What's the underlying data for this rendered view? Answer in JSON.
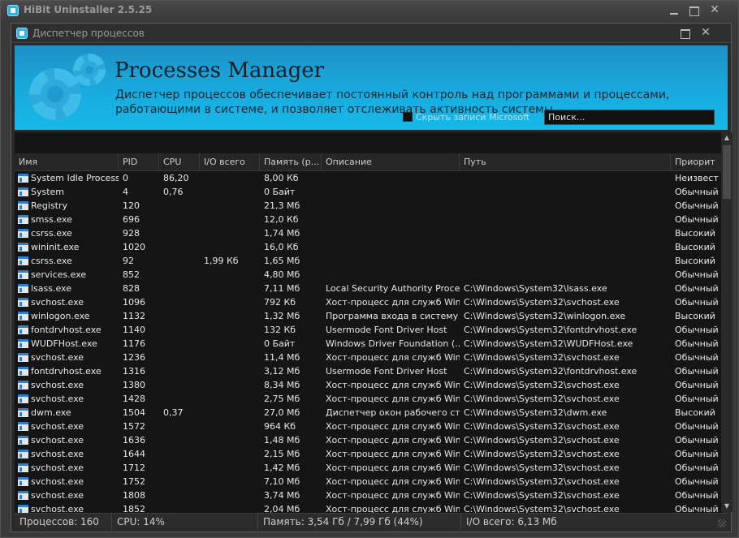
{
  "app": {
    "outer_title": "HiBit Uninstaller 2.5.25",
    "inner_title": "Диспетчер процессов"
  },
  "banner": {
    "title": "Processes Manager",
    "description": "Диспетчер процессов обеспечивает постоянный контроль над программами и процессами, работающими в системе, и позволяет отслеживать активность системы",
    "hide_ms_label": "Скрыть записи Microsoft",
    "search_placeholder": "Поиск..."
  },
  "colors": {
    "accent": "#1aa7db",
    "background": "#151515"
  },
  "table": {
    "columns": [
      "Имя",
      "PID",
      "CPU",
      "I/O всего",
      "Память (р...",
      "Описание",
      "Путь",
      "Приорит"
    ],
    "rows": [
      [
        "System Idle Process",
        "0",
        "86,20",
        "",
        "8,00 Кб",
        "",
        "",
        "Неизвест"
      ],
      [
        "System",
        "4",
        "0,76",
        "",
        "0 Байт",
        "",
        "",
        "Обычный"
      ],
      [
        "Registry",
        "120",
        "",
        "",
        "21,3 Мб",
        "",
        "",
        "Обычный"
      ],
      [
        "smss.exe",
        "696",
        "",
        "",
        "12,0 Кб",
        "",
        "",
        "Обычный"
      ],
      [
        "csrss.exe",
        "928",
        "",
        "",
        "1,74 Мб",
        "",
        "",
        "Высокий"
      ],
      [
        "wininit.exe",
        "1020",
        "",
        "",
        "16,0 Кб",
        "",
        "",
        "Высокий"
      ],
      [
        "csrss.exe",
        "92",
        "",
        "1,99 Кб",
        "1,65 Мб",
        "",
        "",
        "Высокий"
      ],
      [
        "services.exe",
        "852",
        "",
        "",
        "4,80 Мб",
        "",
        "",
        "Обычный"
      ],
      [
        "lsass.exe",
        "828",
        "",
        "",
        "7,11 Мб",
        "Local Security Authority Process",
        "C:\\Windows\\System32\\lsass.exe",
        "Обычный"
      ],
      [
        "svchost.exe",
        "1096",
        "",
        "",
        "792 Кб",
        "Хост-процесс для служб Win...",
        "C:\\Windows\\System32\\svchost.exe",
        "Обычный"
      ],
      [
        "winlogon.exe",
        "1132",
        "",
        "",
        "1,32 Мб",
        "Программа входа в систему ...",
        "C:\\Windows\\System32\\winlogon.exe",
        "Высокий"
      ],
      [
        "fontdrvhost.exe",
        "1140",
        "",
        "",
        "132 Кб",
        "Usermode Font Driver Host",
        "C:\\Windows\\System32\\fontdrvhost.exe",
        "Обычный"
      ],
      [
        "WUDFHost.exe",
        "1176",
        "",
        "",
        "0 Байт",
        "Windows Driver Foundation (...",
        "C:\\Windows\\System32\\WUDFHost.exe",
        "Обычный"
      ],
      [
        "svchost.exe",
        "1236",
        "",
        "",
        "11,4 Мб",
        "Хост-процесс для служб Win...",
        "C:\\Windows\\System32\\svchost.exe",
        "Обычный"
      ],
      [
        "fontdrvhost.exe",
        "1316",
        "",
        "",
        "3,12 Мб",
        "Usermode Font Driver Host",
        "C:\\Windows\\System32\\fontdrvhost.exe",
        "Обычный"
      ],
      [
        "svchost.exe",
        "1380",
        "",
        "",
        "8,34 Мб",
        "Хост-процесс для служб Win...",
        "C:\\Windows\\System32\\svchost.exe",
        "Обычный"
      ],
      [
        "svchost.exe",
        "1428",
        "",
        "",
        "2,75 Мб",
        "Хост-процесс для служб Win...",
        "C:\\Windows\\System32\\svchost.exe",
        "Обычный"
      ],
      [
        "dwm.exe",
        "1504",
        "0,37",
        "",
        "27,0 Мб",
        "Диспетчер окон рабочего ст...",
        "C:\\Windows\\System32\\dwm.exe",
        "Высокий"
      ],
      [
        "svchost.exe",
        "1572",
        "",
        "",
        "964 Кб",
        "Хост-процесс для служб Win...",
        "C:\\Windows\\System32\\svchost.exe",
        "Обычный"
      ],
      [
        "svchost.exe",
        "1636",
        "",
        "",
        "1,48 Мб",
        "Хост-процесс для служб Win...",
        "C:\\Windows\\System32\\svchost.exe",
        "Обычный"
      ],
      [
        "svchost.exe",
        "1644",
        "",
        "",
        "2,15 Мб",
        "Хост-процесс для служб Win...",
        "C:\\Windows\\System32\\svchost.exe",
        "Обычный"
      ],
      [
        "svchost.exe",
        "1712",
        "",
        "",
        "1,42 Мб",
        "Хост-процесс для служб Win...",
        "C:\\Windows\\System32\\svchost.exe",
        "Обычный"
      ],
      [
        "svchost.exe",
        "1752",
        "",
        "",
        "7,10 Мб",
        "Хост-процесс для служб Win...",
        "C:\\Windows\\System32\\svchost.exe",
        "Обычный"
      ],
      [
        "svchost.exe",
        "1808",
        "",
        "",
        "3,74 Мб",
        "Хост-процесс для служб Win...",
        "C:\\Windows\\System32\\svchost.exe",
        "Обычный"
      ],
      [
        "svchost.exe",
        "1852",
        "",
        "",
        "2,04 Мб",
        "Хост-процесс для служб Win...",
        "C:\\Windows\\System32\\svchost.exe",
        "Обычный"
      ]
    ]
  },
  "status": {
    "processes": "Процессов: 160",
    "cpu": "CPU: 14%",
    "memory": "Память: 3,54 Гб / 7,99 Гб (44%)",
    "io": "I/O всего: 6,13 Мб"
  }
}
